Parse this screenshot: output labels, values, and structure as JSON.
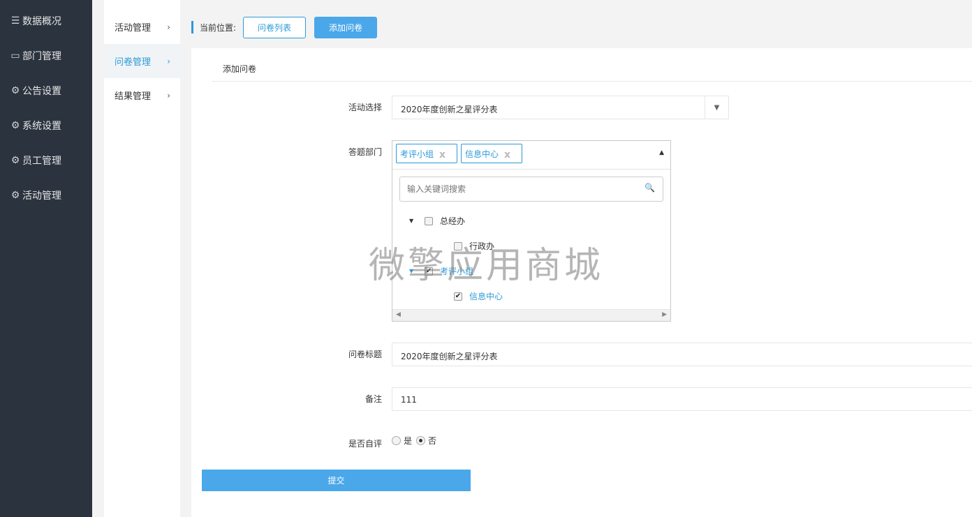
{
  "sidebar": {
    "items": [
      {
        "icon": "menu-icon",
        "glyph": "☰",
        "label": "数据概况"
      },
      {
        "icon": "money-icon",
        "glyph": "▭",
        "label": "部门管理"
      },
      {
        "icon": "gear-icon",
        "glyph": "⚙",
        "label": "公告设置"
      },
      {
        "icon": "gear-icon",
        "glyph": "⚙",
        "label": "系统设置"
      },
      {
        "icon": "gear-icon",
        "glyph": "⚙",
        "label": "员工管理"
      },
      {
        "icon": "gear-icon",
        "glyph": "⚙",
        "label": "活动管理"
      }
    ]
  },
  "submenu": {
    "items": [
      {
        "label": "活动管理",
        "active": false
      },
      {
        "label": "问卷管理",
        "active": true
      },
      {
        "label": "结果管理",
        "active": false
      }
    ],
    "chevron": "›"
  },
  "breadcrumb": {
    "label": "当前位置:",
    "list_button": "问卷列表",
    "add_button": "添加问卷"
  },
  "panel": {
    "title": "添加问卷"
  },
  "form": {
    "activity": {
      "label": "活动选择",
      "value": "2020年度创新之星评分表",
      "arrow": "▼"
    },
    "department": {
      "label": "答题部门",
      "tags": [
        {
          "label": "考评小组",
          "close": "x"
        },
        {
          "label": "信息中心",
          "close": "x"
        }
      ],
      "caret": "▲",
      "search_placeholder": "输入关键词搜索",
      "search_icon": "🔍",
      "tree": [
        {
          "label": "总经办",
          "expanded": true,
          "checked": false,
          "level": 0,
          "toggle": "▼"
        },
        {
          "label": "行政办",
          "checked": false,
          "level": 1
        },
        {
          "label": "考评小组",
          "expanded": true,
          "checked": true,
          "level": 0,
          "toggle": "▼"
        },
        {
          "label": "信息中心",
          "checked": true,
          "level": 1
        }
      ],
      "check_mark": "✔",
      "scroll_left": "◀",
      "scroll_right": "▶"
    },
    "title": {
      "label": "问卷标题",
      "value": "2020年度创新之星评分表"
    },
    "remark": {
      "label": "备注",
      "value": "111"
    },
    "self_eval": {
      "label": "是否自评",
      "options": [
        {
          "label": "是",
          "selected": false
        },
        {
          "label": "否",
          "selected": true
        }
      ]
    },
    "submit_label": "提交"
  },
  "watermark": "微擎应用商城"
}
